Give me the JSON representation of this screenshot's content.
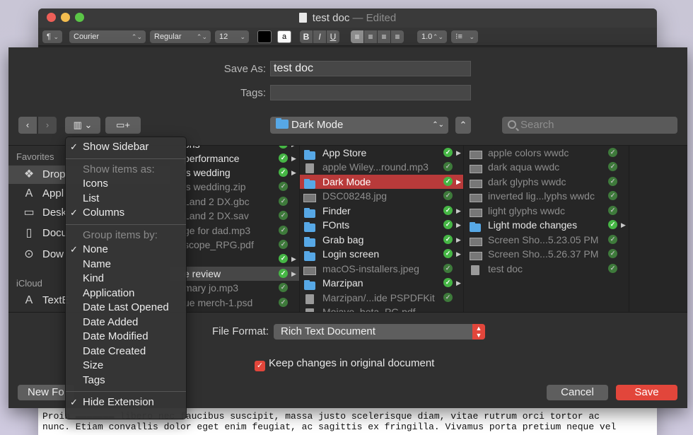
{
  "doc_window": {
    "title": "test doc",
    "edited": "— Edited",
    "toolbar": {
      "paragraph_style": "¶",
      "font_family": "Courier",
      "font_style": "Regular",
      "font_size": "12",
      "text_color": "#000000",
      "bold": "B",
      "italic": "I",
      "underline": "U",
      "line_spacing": "1.0"
    },
    "body_lines": [
      "Proin ▬▬▬▬▬▬▬ libero nec faucibus suscipit, massa justo scelerisque diam, vitae rutrum orci tortor ac",
      "nunc. Etiam convallis dolor eget enim feugiat, ac sagittis ex fringilla. Vivamus porta pretium neque vel"
    ]
  },
  "save_sheet": {
    "save_as_label": "Save As:",
    "save_as_value": "test doc",
    "tags_label": "Tags:",
    "tags_value": "",
    "location": "Dark Mode",
    "search_placeholder": "Search",
    "file_format_label": "File Format:",
    "file_format_value": "Rich Text Document",
    "keep_changes_label": "Keep changes in original document",
    "new_folder_label": "New Fo",
    "cancel_label": "Cancel",
    "save_label": "Save"
  },
  "sidebar": {
    "favorites_label": "Favorites",
    "icloud_label": "iCloud",
    "items": [
      {
        "label": "Drop",
        "icon": "dropbox-icon"
      },
      {
        "label": "Appl",
        "icon": "applications-icon"
      },
      {
        "label": "Desk",
        "icon": "desktop-icon"
      },
      {
        "label": "Docu",
        "icon": "documents-icon"
      },
      {
        "label": "Dow",
        "icon": "downloads-icon"
      }
    ],
    "icloud_items": [
      {
        "label": "TextE",
        "icon": "textedit-icon"
      }
    ]
  },
  "column1": [
    {
      "label": "ons",
      "dim": false
    },
    {
      "label": "performance",
      "dim": false
    },
    {
      "label": "'s wedding",
      "dim": false
    },
    {
      "label": "'s wedding.zip",
      "dim": true
    },
    {
      "label": "Land 2 DX.gbc",
      "dim": true
    },
    {
      "label": "Land 2 DX.sav",
      "dim": true
    },
    {
      "label": "ge for dad.mp3",
      "dim": true
    },
    {
      "label": "scope_RPG.pdf",
      "dim": true
    },
    {
      "label": "",
      "dim": true
    },
    {
      "label": "e review",
      "dim": false
    },
    {
      "label": "mary jo.mp3",
      "dim": true
    },
    {
      "label": "ue merch-1.psd",
      "dim": true
    }
  ],
  "column2": [
    {
      "label": "App Store",
      "kind": "folder",
      "dim": false
    },
    {
      "label": "apple Wiley...round.mp3",
      "kind": "file",
      "dim": true
    },
    {
      "label": "Dark Mode",
      "kind": "folder",
      "dim": false
    },
    {
      "label": "DSC08248.jpg",
      "kind": "image",
      "dim": true
    },
    {
      "label": "Finder",
      "kind": "folder",
      "dim": false
    },
    {
      "label": "FOnts",
      "kind": "folder",
      "dim": false
    },
    {
      "label": "Grab bag",
      "kind": "folder",
      "dim": false
    },
    {
      "label": "Login screen",
      "kind": "folder",
      "dim": false
    },
    {
      "label": "macOS-installers.jpeg",
      "kind": "image",
      "dim": true
    },
    {
      "label": "Marzipan",
      "kind": "folder",
      "dim": false
    },
    {
      "label": "Marzipan/...ide PSPDFKit",
      "kind": "file",
      "dim": true
    },
    {
      "label": "Mojave_beta_PG.pdf",
      "kind": "file",
      "dim": true
    }
  ],
  "column3": [
    {
      "label": "apple colors wwdc",
      "kind": "image",
      "dim": true
    },
    {
      "label": "dark aqua wwdc",
      "kind": "image",
      "dim": true
    },
    {
      "label": "dark glyphs wwdc",
      "kind": "image",
      "dim": true
    },
    {
      "label": "inverted lig...lyphs wwdc",
      "kind": "image",
      "dim": true
    },
    {
      "label": "light glyphs wwdc",
      "kind": "image",
      "dim": true
    },
    {
      "label": "Light mode changes",
      "kind": "folder",
      "dim": false
    },
    {
      "label": "Screen Sho...5.23.05 PM",
      "kind": "image",
      "dim": true
    },
    {
      "label": "Screen Sho...5.26.37 PM",
      "kind": "image",
      "dim": true
    },
    {
      "label": "test doc",
      "kind": "file",
      "dim": true
    }
  ],
  "menu": {
    "show_sidebar": "Show Sidebar",
    "show_items_as": "Show items as:",
    "icons": "Icons",
    "list": "List",
    "columns": "Columns",
    "group_items_by": "Group items by:",
    "group_options": [
      "None",
      "Name",
      "Kind",
      "Application",
      "Date Last Opened",
      "Date Added",
      "Date Modified",
      "Date Created",
      "Size",
      "Tags"
    ],
    "hide_extension": "Hide Extension",
    "checkmark": "✓"
  },
  "colors": {
    "accent": "#e2463b",
    "selection": "#b83a3a",
    "tag_green": "#46b645",
    "folder_blue": "#57a8e6"
  }
}
